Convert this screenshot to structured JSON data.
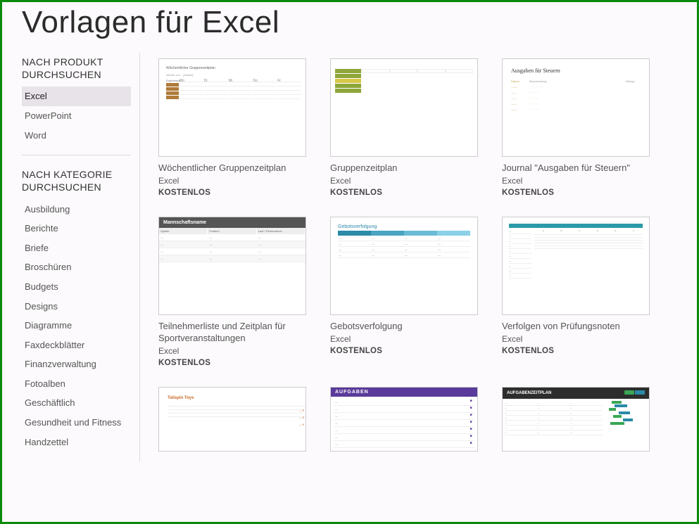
{
  "page": {
    "title": "Vorlagen für Excel"
  },
  "sidebar": {
    "product_heading": "NACH PRODUKT DURCHSUCHEN",
    "products": [
      {
        "label": "Excel",
        "selected": true
      },
      {
        "label": "PowerPoint",
        "selected": false
      },
      {
        "label": "Word",
        "selected": false
      }
    ],
    "category_heading": "NACH KATEGORIE DURCHSUCHEN",
    "categories": [
      "Ausbildung",
      "Berichte",
      "Briefe",
      "Broschüren",
      "Budgets",
      "Designs",
      "Diagramme",
      "Faxdeckblätter",
      "Finanzverwaltung",
      "Fotoalben",
      "Geschäftlich",
      "Gesundheit und Fitness",
      "Handzettel"
    ]
  },
  "templates": [
    {
      "title": "Wöchentlicher Gruppenzeitplan",
      "app": "Excel",
      "price": "KOSTENLOS",
      "thumb": {
        "caption": "Wöchentlicher Gruppenzeitplan"
      }
    },
    {
      "title": "Gruppenzeitplan",
      "app": "Excel",
      "price": "KOSTENLOS",
      "thumb": {}
    },
    {
      "title": "Journal \"Ausgaben für Steuern\"",
      "app": "Excel",
      "price": "KOSTENLOS",
      "thumb": {
        "caption": "Ausgaben für Steuern"
      }
    },
    {
      "title": "Teilnehmerliste und Zeitplan für Sportveranstaltungen",
      "app": "Excel",
      "price": "KOSTENLOS",
      "thumb": {
        "caption": "Mannschaftsname"
      }
    },
    {
      "title": "Gebotsverfolgung",
      "app": "Excel",
      "price": "KOSTENLOS",
      "thumb": {
        "caption": "Gebotsverfolgung"
      }
    },
    {
      "title": "Verfolgen von Prüfungsnoten",
      "app": "Excel",
      "price": "KOSTENLOS",
      "thumb": {}
    },
    {
      "title": "",
      "app": "",
      "price": "",
      "thumb": {
        "caption": "Tailspin Toys"
      }
    },
    {
      "title": "",
      "app": "",
      "price": "",
      "thumb": {
        "caption": "AUFGABEN"
      }
    },
    {
      "title": "",
      "app": "",
      "price": "",
      "thumb": {
        "caption": "AUFGABENZEITPLAN"
      }
    }
  ]
}
